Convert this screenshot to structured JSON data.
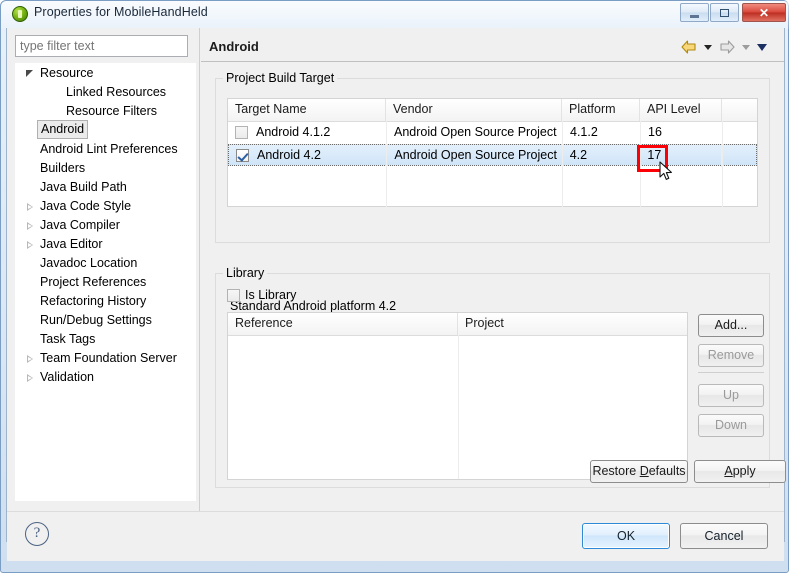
{
  "window": {
    "title": "Properties for MobileHandHeld",
    "app_icon": "eclipse-green-icon",
    "controls": {
      "minimize": "minimize-icon",
      "maximize": "maximize-icon",
      "close": "✕"
    }
  },
  "sidebar": {
    "filter": {
      "value": "",
      "placeholder": "type filter text"
    },
    "items": [
      {
        "label": "Resource",
        "indent": 0,
        "arrow": "expanded",
        "selected": false
      },
      {
        "label": "Linked Resources",
        "indent": 1,
        "arrow": "none",
        "selected": false
      },
      {
        "label": "Resource Filters",
        "indent": 1,
        "arrow": "none",
        "selected": false
      },
      {
        "label": "Android",
        "indent": 0,
        "arrow": "none",
        "selected": true
      },
      {
        "label": "Android Lint Preferences",
        "indent": 0,
        "arrow": "none",
        "selected": false
      },
      {
        "label": "Builders",
        "indent": 0,
        "arrow": "none",
        "selected": false
      },
      {
        "label": "Java Build Path",
        "indent": 0,
        "arrow": "none",
        "selected": false
      },
      {
        "label": "Java Code Style",
        "indent": 0,
        "arrow": "collapsed",
        "selected": false
      },
      {
        "label": "Java Compiler",
        "indent": 0,
        "arrow": "collapsed",
        "selected": false
      },
      {
        "label": "Java Editor",
        "indent": 0,
        "arrow": "collapsed",
        "selected": false
      },
      {
        "label": "Javadoc Location",
        "indent": 0,
        "arrow": "none",
        "selected": false
      },
      {
        "label": "Project References",
        "indent": 0,
        "arrow": "none",
        "selected": false
      },
      {
        "label": "Refactoring History",
        "indent": 0,
        "arrow": "none",
        "selected": false
      },
      {
        "label": "Run/Debug Settings",
        "indent": 0,
        "arrow": "none",
        "selected": false
      },
      {
        "label": "Task Tags",
        "indent": 0,
        "arrow": "none",
        "selected": false
      },
      {
        "label": "Team Foundation Server",
        "indent": 0,
        "arrow": "collapsed",
        "selected": false
      },
      {
        "label": "Validation",
        "indent": 0,
        "arrow": "collapsed",
        "selected": false
      }
    ]
  },
  "page": {
    "title": "Android",
    "nav": {
      "back": "back-arrow-icon",
      "back_menu": "chevron-down-icon",
      "forward": "forward-arrow-icon",
      "forward_menu": "chevron-down-icon",
      "view_menu": "chevron-down-icon"
    }
  },
  "build_target": {
    "legend": "Project Build Target",
    "columns": [
      "Target Name",
      "Vendor",
      "Platform",
      "API Level",
      ""
    ],
    "rows": [
      {
        "checked": false,
        "selected": false,
        "target_name": "Android 4.1.2",
        "vendor": "Android Open Source Project",
        "platform": "4.1.2",
        "api_level": "16",
        "extra": ""
      },
      {
        "checked": true,
        "selected": true,
        "target_name": "Android 4.2",
        "vendor": "Android Open Source Project",
        "platform": "4.2",
        "api_level": "17",
        "extra": ""
      }
    ],
    "description": "Standard Android platform 4.2",
    "highlight": {
      "target": "api-level-cell-row-2",
      "color": "#fb0006"
    }
  },
  "library": {
    "legend": "Library",
    "is_library": {
      "label": "Is Library",
      "checked": false
    },
    "columns": [
      "Reference",
      "Project"
    ],
    "rows": [],
    "buttons": [
      {
        "label": "Add...",
        "enabled": true
      },
      {
        "label": "Remove",
        "enabled": false
      },
      {
        "label": "Up",
        "enabled": false
      },
      {
        "label": "Down",
        "enabled": false
      }
    ]
  },
  "page_actions": {
    "restore_defaults": {
      "pre": "Restore ",
      "mnemonic": "D",
      "post": "efaults"
    },
    "apply": {
      "pre": "",
      "mnemonic": "A",
      "post": "pply"
    }
  },
  "footer": {
    "help": "?",
    "ok": "OK",
    "cancel": "Cancel"
  }
}
